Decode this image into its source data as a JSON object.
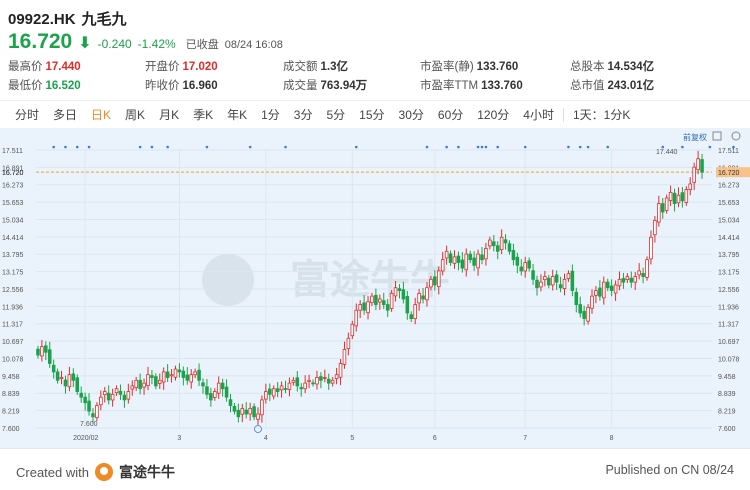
{
  "header": {
    "symbol": "09922.HK",
    "name": "九毛九",
    "price": "16.720",
    "change": "-0.240",
    "change_pct": "-1.42%",
    "market_status": "已收盘",
    "datetime": "08/24 16:08"
  },
  "stats": {
    "high_label": "最高价",
    "high": "17.440",
    "low_label": "最低价",
    "low": "16.520",
    "open_label": "开盘价",
    "open": "17.020",
    "prev_close_label": "昨收价",
    "prev_close": "16.960",
    "turnover_label": "成交额",
    "turnover": "1.3亿",
    "volume_label": "成交量",
    "volume": "763.94万",
    "pe_static_label": "市盈率(静)",
    "pe_static": "133.760",
    "pe_ttm_label": "市盈率TTM",
    "pe_ttm": "133.760",
    "shares_label": "总股本",
    "shares": "14.534亿",
    "market_cap_label": "总市值",
    "market_cap": "243.01亿"
  },
  "tabs": [
    "分时",
    "多日",
    "日K",
    "周K",
    "月K",
    "季K",
    "年K",
    "1分",
    "3分",
    "5分",
    "15分",
    "30分",
    "60分",
    "120分",
    "4小时",
    "1天：1分K"
  ],
  "active_tab": "日K",
  "chart_controls": {
    "adjust_label": "前复权"
  },
  "chart_data": {
    "type": "candlestick",
    "y_ticks": [
      "17.511",
      "16.891",
      "16.720",
      "16.273",
      "15.653",
      "15.034",
      "14.414",
      "13.795",
      "13.175",
      "12.556",
      "11.936",
      "11.317",
      "10.697",
      "10.078",
      "9.458",
      "8.839",
      "8.219",
      "7.600"
    ],
    "x_ticks": [
      "2020/02",
      "3",
      "4",
      "5",
      "6",
      "7",
      "8"
    ],
    "ylim": [
      7.6,
      17.511
    ],
    "last_price_line": 16.72,
    "annotations": {
      "high_label": "17.440",
      "low_label": "7.600"
    },
    "up_color": "#e02b2b",
    "down_color": "#1aa34a",
    "watermark": "富途牛牛",
    "closes": [
      10.2,
      10.5,
      10.3,
      9.9,
      9.6,
      9.3,
      9.4,
      9.1,
      9.5,
      9.3,
      8.9,
      8.7,
      8.5,
      8.2,
      8.0,
      8.4,
      8.7,
      8.9,
      8.6,
      8.8,
      9.0,
      8.8,
      8.6,
      8.9,
      9.1,
      9.3,
      9.0,
      9.2,
      9.5,
      9.4,
      9.1,
      9.3,
      9.6,
      9.4,
      9.5,
      9.7,
      9.6,
      9.4,
      9.3,
      9.5,
      9.6,
      9.3,
      9.1,
      8.8,
      8.6,
      8.9,
      9.2,
      9.0,
      8.7,
      8.4,
      8.2,
      8.0,
      8.3,
      8.1,
      8.3,
      8.0,
      8.1,
      8.6,
      8.9,
      8.8,
      9.0,
      8.9,
      9.1,
      9.0,
      9.2,
      9.3,
      9.1,
      9.0,
      9.2,
      9.3,
      9.2,
      9.4,
      9.3,
      9.4,
      9.2,
      9.3,
      9.5,
      9.9,
      10.4,
      10.8,
      11.3,
      11.8,
      12.0,
      11.8,
      12.1,
      12.3,
      12.0,
      12.2,
      12.0,
      11.8,
      12.4,
      12.6,
      12.5,
      12.2,
      11.7,
      11.5,
      12.0,
      12.4,
      12.2,
      12.6,
      12.9,
      12.7,
      13.2,
      13.6,
      13.9,
      13.5,
      13.7,
      13.5,
      13.3,
      13.8,
      13.6,
      13.4,
      13.8,
      13.6,
      14.0,
      14.3,
      14.1,
      13.9,
      14.4,
      14.2,
      13.9,
      13.6,
      13.4,
      13.2,
      13.5,
      13.3,
      12.9,
      12.6,
      12.8,
      13.0,
      12.7,
      13.0,
      12.8,
      12.6,
      12.9,
      13.1,
      12.5,
      12.0,
      11.7,
      11.5,
      11.9,
      12.3,
      12.5,
      12.3,
      12.8,
      12.6,
      12.5,
      12.7,
      12.9,
      12.8,
      13.0,
      12.8,
      13.0,
      13.2,
      13.0,
      13.6,
      14.4,
      15.0,
      15.6,
      15.3,
      15.8,
      16.0,
      15.6,
      15.9,
      15.7,
      16.1,
      16.3,
      16.9,
      17.2,
      16.72
    ]
  }
}
